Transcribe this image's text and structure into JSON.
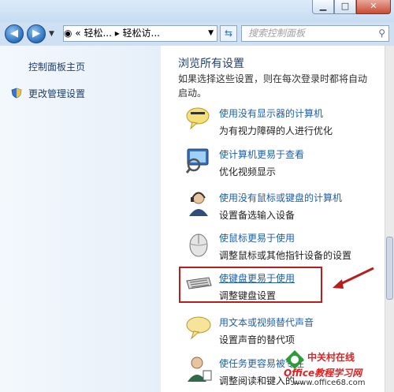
{
  "window": {
    "min": "▁",
    "max": "□",
    "close": "✕"
  },
  "nav": {
    "back_icon": "arrow-left",
    "forward_icon": "arrow-right",
    "address": "◉  «  轻松...  ▸  轻松访...",
    "refresh": "⇆",
    "search_placeholder": "搜索控制面板"
  },
  "sidebar": {
    "home": "控制面板主页",
    "admin": "更改管理设置"
  },
  "main": {
    "title": "浏览所有设置",
    "description": "如果选择这些设置，则在每次登录时都将自动启动。",
    "items": [
      {
        "link": "使用没有显示器的计算机",
        "sub": "为有视力障碍的人进行优化",
        "icon": "speech-bubble-icon"
      },
      {
        "link": "使计算机更易于查看",
        "sub": "优化视频显示",
        "icon": "monitor-magnifier-icon"
      },
      {
        "link": "使用没有鼠标或键盘的计算机",
        "sub": "设置备选输入设备",
        "icon": "person-headset-icon"
      },
      {
        "link": "使鼠标更易于使用",
        "sub": "调整鼠标或其他指针设备的设置",
        "icon": "mouse-icon"
      },
      {
        "link": "使键盘更易于使用",
        "sub": "调整键盘设置",
        "icon": "keyboard-icon"
      },
      {
        "link": "用文本或视频替代声音",
        "sub": "设置声音的替代项",
        "icon": "caption-bubble-icon"
      },
      {
        "link": "使任务更容易被专注",
        "sub": "调整阅读和键入的...",
        "icon": "person-task-icon"
      }
    ]
  },
  "watermark": {
    "line1": "中关村在线",
    "line2": "Office教程学习网",
    "line3": "www.office68.com"
  },
  "colors": {
    "highlight": "#b81e1e",
    "link": "#1f5fa8"
  }
}
